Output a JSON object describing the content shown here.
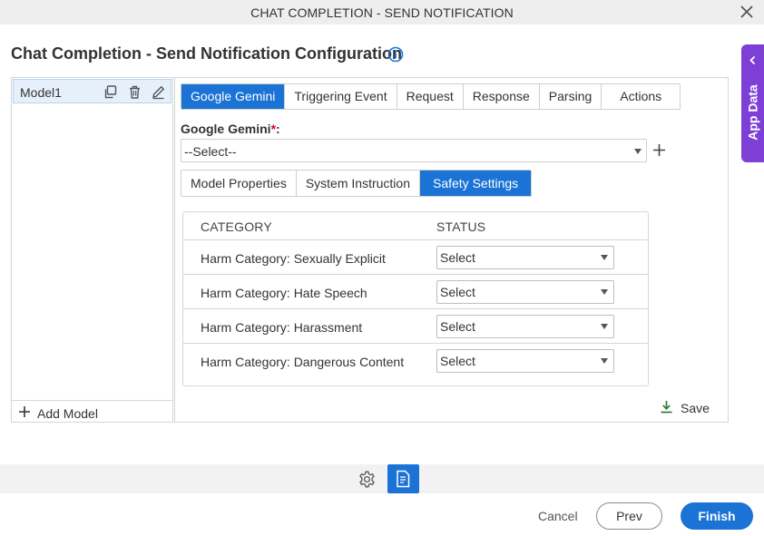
{
  "window": {
    "title": "CHAT COMPLETION - SEND NOTIFICATION",
    "close_icon": "close-icon"
  },
  "page": {
    "title": "Chat Completion - Send Notification Configuration",
    "info_icon": "info-icon"
  },
  "side_tab": {
    "label": "App Data",
    "icon": "chevron-left-icon",
    "color": "#7e3fd6"
  },
  "models": {
    "items": [
      {
        "label": "Model1",
        "selected": true
      }
    ],
    "item_icons": [
      "copy-icon",
      "trash-icon",
      "edit-icon"
    ],
    "add_label": "Add Model"
  },
  "tabs": [
    {
      "label": "Google Gemini",
      "active": true
    },
    {
      "label": "Triggering Event",
      "active": false
    },
    {
      "label": "Request",
      "active": false
    },
    {
      "label": "Response",
      "active": false
    },
    {
      "label": "Parsing",
      "active": false
    },
    {
      "label": "Actions",
      "active": false
    }
  ],
  "gemini": {
    "label": "Google Gemini",
    "required_mark": "*",
    "label_suffix": ":",
    "value": "--Select--",
    "add_icon": "plus-icon"
  },
  "sub_tabs": [
    {
      "label": "Model Properties",
      "active": false
    },
    {
      "label": "System Instruction",
      "active": false
    },
    {
      "label": "Safety Settings",
      "active": true
    }
  ],
  "safety_table": {
    "headers": {
      "category": "CATEGORY",
      "status": "STATUS"
    },
    "rows": [
      {
        "category": "Harm Category: Sexually Explicit",
        "status": "Select"
      },
      {
        "category": "Harm Category: Hate Speech",
        "status": "Select"
      },
      {
        "category": "Harm Category: Harassment",
        "status": "Select"
      },
      {
        "category": "Harm Category: Dangerous Content",
        "status": "Select"
      }
    ]
  },
  "save": {
    "label": "Save",
    "icon": "download-icon",
    "icon_color": "#2e7d32"
  },
  "toolbar": {
    "icons": [
      "gear-icon",
      "document-icon"
    ]
  },
  "footer": {
    "cancel_label": "Cancel",
    "prev_label": "Prev",
    "finish_label": "Finish"
  },
  "colors": {
    "accent": "#1a73d5",
    "required": "#d0021b"
  }
}
